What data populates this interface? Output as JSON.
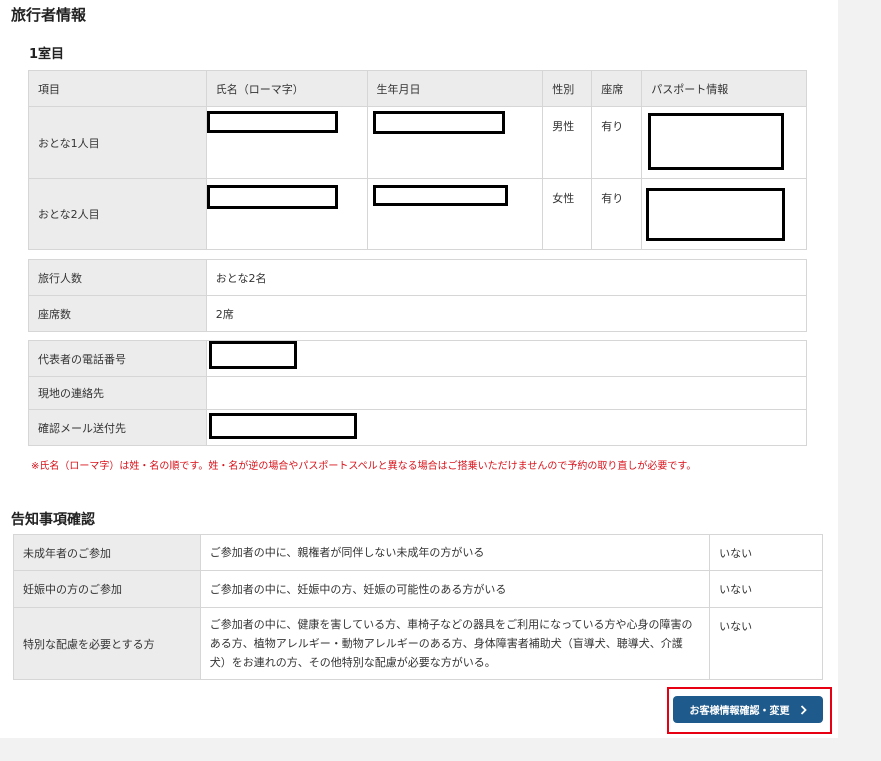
{
  "traveler_section": {
    "title": "旅行者情報",
    "room_title": "1室目",
    "table_headers": [
      "項目",
      "氏名（ローマ字）",
      "生年月日",
      "性別",
      "座席",
      "パスポート情報"
    ],
    "rows": [
      {
        "label": "おとな1人目",
        "gender": "男性",
        "seat": "有り"
      },
      {
        "label": "おとな2人目",
        "gender": "女性",
        "seat": "有り"
      }
    ],
    "summary": [
      {
        "label": "旅行人数",
        "value": "おとな2名"
      },
      {
        "label": "座席数",
        "value": "2席"
      }
    ],
    "contacts": [
      {
        "label": "代表者の電話番号"
      },
      {
        "label": "現地の連絡先"
      },
      {
        "label": "確認メール送付先"
      }
    ],
    "warning": "※氏名（ローマ字）は姓・名の順です。姓・名が逆の場合やパスポートスペルと異なる場合はご搭乗いただけませんので予約の取り直しが必要です。"
  },
  "notice_section": {
    "title": "告知事項確認",
    "rows": [
      {
        "label": "未成年者のご参加",
        "text": "ご参加者の中に、親権者が同伴しない未成年の方がいる",
        "answer": "いない"
      },
      {
        "label": "妊娠中の方のご参加",
        "text": "ご参加者の中に、妊娠中の方、妊娠の可能性のある方がいる",
        "answer": "いない"
      },
      {
        "label": "特別な配慮を必要とする方",
        "text": "ご参加者の中に、健康を害している方、車椅子などの器具をご利用になっている方や心身の障害のある方、植物アレルギー・動物アレルギーのある方、身体障害者補助犬（盲導犬、聴導犬、介護犬）をお連れの方、その他特別な配慮が必要な方がいる。",
        "answer": "いない"
      }
    ]
  },
  "actions": {
    "confirm_button_label": "お客様情報確認・変更",
    "confirm_button_icon": "chevron-right-icon"
  },
  "colors": {
    "button_bg": "#1f5a8c",
    "highlight_border": "#e60012",
    "warning_text": "#d9131b",
    "header_bg": "#ececec"
  }
}
